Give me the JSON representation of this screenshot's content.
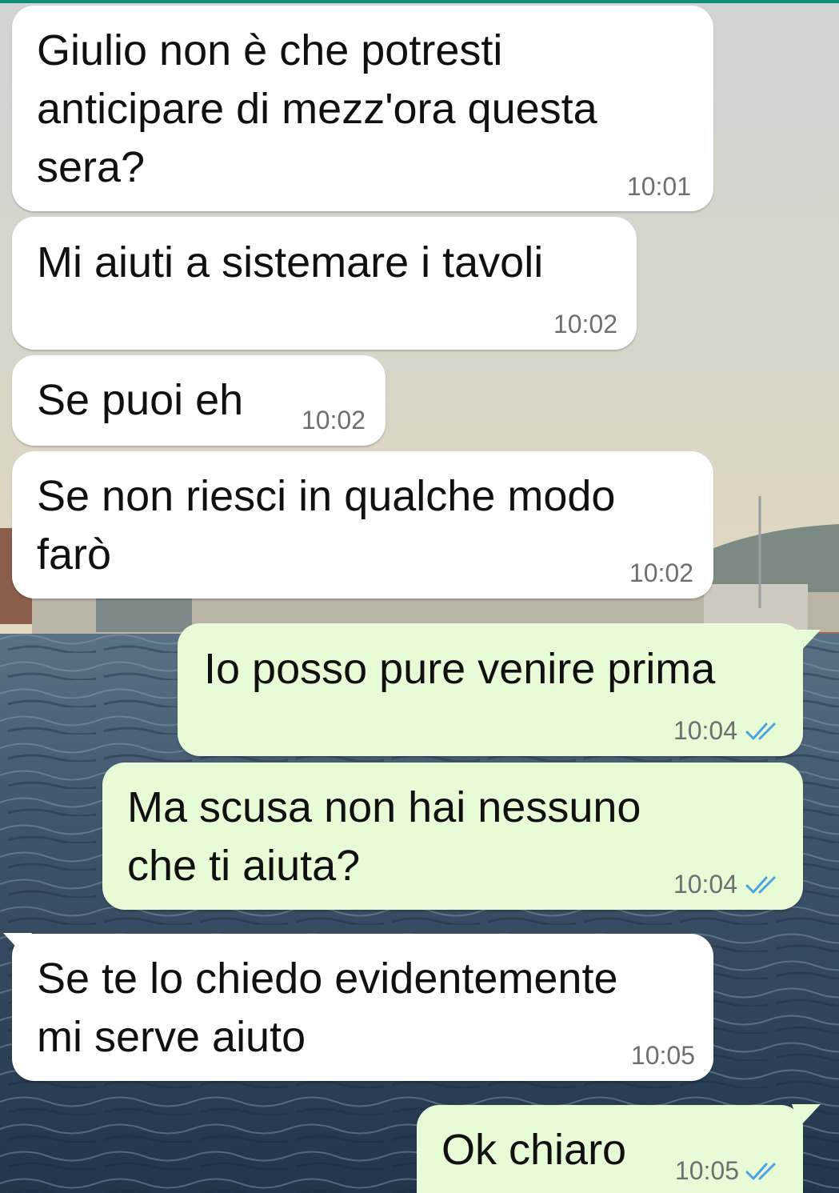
{
  "theme": {
    "incoming_bubble": "#ffffff",
    "outgoing_bubble": "#e7fcd6",
    "read_tick_color": "#4aa3df",
    "header_accent": "#0f8d7a"
  },
  "chat": {
    "wallpaper": "harbor-sea-photo",
    "messages": [
      {
        "direction": "incoming",
        "text": "Giulio non è che potresti\nanticipare di mezz'ora questa\nsera?",
        "time": "10:01"
      },
      {
        "direction": "incoming",
        "text": "Mi aiuti a sistemare i tavoli",
        "time": "10:02"
      },
      {
        "direction": "incoming",
        "text": "Se puoi eh",
        "time": "10:02"
      },
      {
        "direction": "incoming",
        "text": "Se non riesci in qualche modo\nfarò",
        "time": "10:02"
      },
      {
        "direction": "outgoing",
        "text": "Io posso pure venire prima",
        "time": "10:04",
        "status_icon": "double-check-icon"
      },
      {
        "direction": "outgoing",
        "text": "Ma scusa non hai nessuno\nche ti aiuta?",
        "time": "10:04",
        "status_icon": "double-check-icon"
      },
      {
        "direction": "incoming",
        "text": "Se te lo chiedo evidentemente\nmi serve aiuto",
        "time": "10:05"
      },
      {
        "direction": "outgoing",
        "text": "Ok chiaro",
        "time": "10:05",
        "status_icon": "double-check-icon"
      }
    ]
  }
}
